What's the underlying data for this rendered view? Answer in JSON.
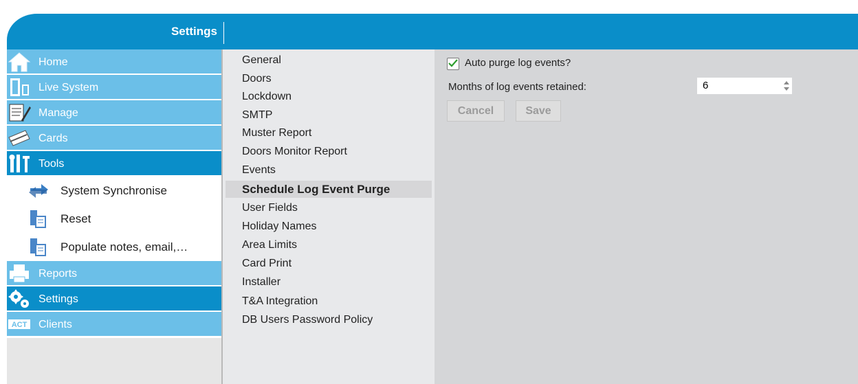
{
  "header": {
    "title": "Settings"
  },
  "sidebar": {
    "items": [
      {
        "label": "Home",
        "icon": "home-icon"
      },
      {
        "label": "Live System",
        "icon": "door-icon"
      },
      {
        "label": "Manage",
        "icon": "notepad-icon"
      },
      {
        "label": "Cards",
        "icon": "cards-icon"
      },
      {
        "label": "Tools",
        "icon": "tools-icon"
      },
      {
        "label": "Reports",
        "icon": "printer-icon"
      },
      {
        "label": "Settings",
        "icon": "gears-icon"
      },
      {
        "label": "Clients",
        "icon": "act-logo-icon"
      }
    ],
    "tools_sub": [
      {
        "label": "System Synchronise",
        "icon": "sync-icon"
      },
      {
        "label": "Reset",
        "icon": "server-icon"
      },
      {
        "label": "Populate notes, email,…",
        "icon": "server-icon"
      }
    ]
  },
  "menu": {
    "items": [
      "General",
      "Doors",
      "Lockdown",
      "SMTP",
      "Muster Report",
      "Doors Monitor Report",
      "Events",
      "Schedule Log Event Purge",
      "User Fields",
      "Holiday Names",
      "Area Limits",
      "Card Print",
      "Installer",
      "T&A Integration",
      "DB Users Password Policy"
    ],
    "selected": "Schedule Log Event Purge"
  },
  "form": {
    "auto_purge_label": "Auto purge log events?",
    "auto_purge_checked": true,
    "months_label": "Months of log events retained:",
    "months_value": "6",
    "cancel_label": "Cancel",
    "save_label": "Save"
  },
  "colors": {
    "accent": "#0a8ec9",
    "nav_light": "#6bbfe8",
    "pane_bg": "#d5d6d8",
    "menu_bg": "#e8e9eb"
  }
}
